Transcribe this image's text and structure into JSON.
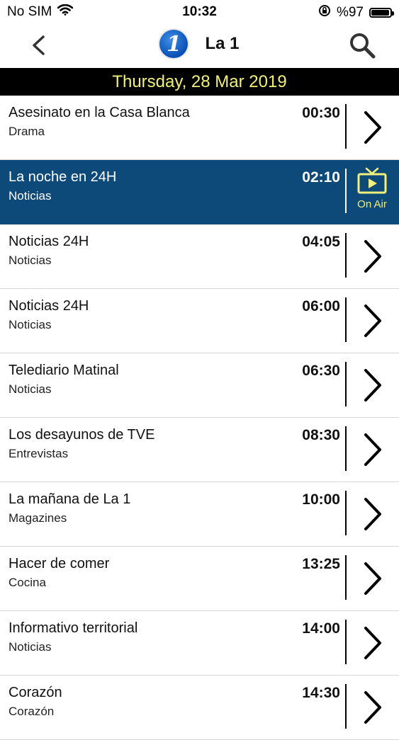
{
  "status": {
    "carrier": "No SIM",
    "time": "10:32",
    "battery": "%97",
    "battery_level": 0.97
  },
  "nav": {
    "title": "La 1",
    "logo_text": "1"
  },
  "date_banner": "Thursday, 28 Mar 2019",
  "programs": [
    {
      "title": "Asesinato en la Casa Blanca",
      "genre": "Drama",
      "time": "00:30"
    },
    {
      "title": "La noche en 24H",
      "genre": "Noticias",
      "time": "02:10",
      "on_air": true,
      "badge": "On Air"
    },
    {
      "title": "Noticias 24H",
      "genre": "Noticias",
      "time": "04:05"
    },
    {
      "title": "Noticias 24H",
      "genre": "Noticias",
      "time": "06:00"
    },
    {
      "title": "Telediario Matinal",
      "genre": "Noticias",
      "time": "06:30"
    },
    {
      "title": "Los desayunos de TVE",
      "genre": "Entrevistas",
      "time": "08:30"
    },
    {
      "title": "La mañana de La 1",
      "genre": "Magazines",
      "time": "10:00"
    },
    {
      "title": "Hacer de comer",
      "genre": "Cocina",
      "time": "13:25"
    },
    {
      "title": "Informativo territorial",
      "genre": "Noticias",
      "time": "14:00"
    },
    {
      "title": "Corazón",
      "genre": "Corazón",
      "time": "14:30"
    }
  ],
  "colors": {
    "on_air_bg": "#0d4a7a",
    "accent_yellow": "#f2f07a",
    "banner_bg": "#000000"
  },
  "icons": {
    "back": "chevron-left-icon",
    "search": "magnifier-icon",
    "row": "chevron-right-icon",
    "on_air": "tv-play-icon"
  }
}
